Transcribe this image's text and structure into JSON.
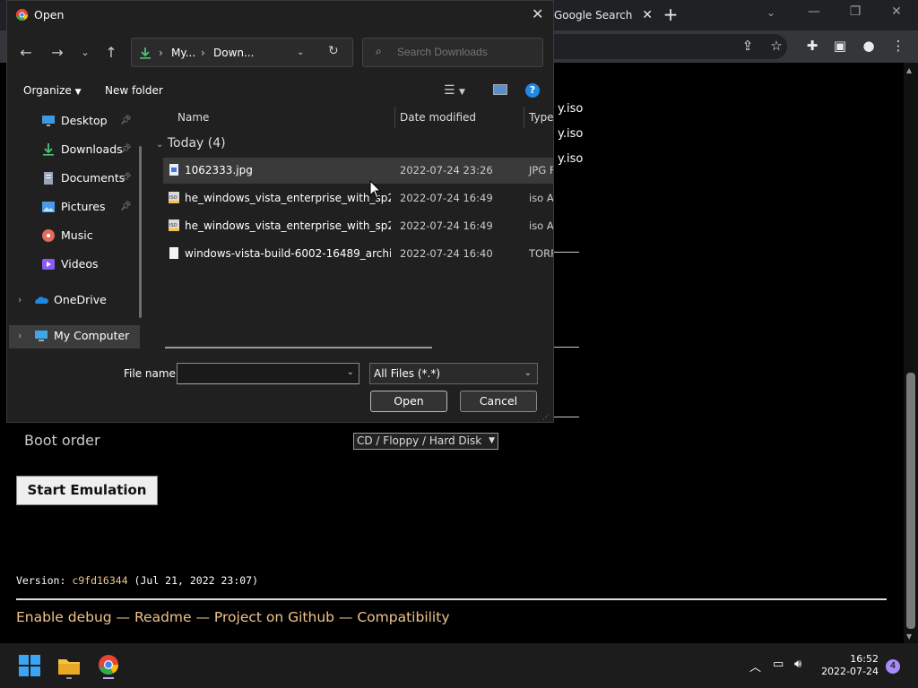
{
  "browser": {
    "tab_title": "Google Search",
    "tab_close": "✕",
    "new_tab": "+",
    "minimize": "—",
    "restore": "❐",
    "close": "✕"
  },
  "webpage": {
    "iso_lines": [
      "y.iso",
      "y.iso",
      "y.iso"
    ],
    "boot_order_label": "Boot order",
    "boot_order_value": "CD / Floppy / Hard Disk",
    "start_button": "Start Emulation",
    "version_prefix": "Version: ",
    "version_hash": "c9fd16344",
    "version_date": " (Jul 21, 2022 23:07)",
    "footer_links": [
      "Enable debug",
      "Readme",
      "Project on Github",
      "Compatibility"
    ],
    "footer_separator": " — "
  },
  "dialog": {
    "title": "Open",
    "close": "✕",
    "breadcrumb": [
      "My...",
      "Down..."
    ],
    "search_placeholder": "Search Downloads",
    "organize_label": "Organize",
    "new_folder_label": "New folder",
    "nav_items": [
      {
        "label": "Desktop",
        "icon": "desktop-icon",
        "pinned": true
      },
      {
        "label": "Downloads",
        "icon": "downloads-icon",
        "pinned": true
      },
      {
        "label": "Documents",
        "icon": "documents-icon",
        "pinned": true
      },
      {
        "label": "Pictures",
        "icon": "pictures-icon",
        "pinned": true
      },
      {
        "label": "Music",
        "icon": "music-icon",
        "pinned": false
      },
      {
        "label": "Videos",
        "icon": "videos-icon",
        "pinned": false
      },
      {
        "label": "OneDrive",
        "icon": "onedrive-icon",
        "pinned": false
      },
      {
        "label": "My Computer",
        "icon": "computer-icon",
        "pinned": false,
        "selected": true
      }
    ],
    "columns": {
      "name": "Name",
      "date": "Date modified",
      "type": "Type"
    },
    "group_label": "Today (4)",
    "files": [
      {
        "name": "1062333.jpg",
        "date": "2022-07-24 23:26",
        "type": "JPG F",
        "icon": "image-file-icon",
        "selected": true
      },
      {
        "name": "he_windows_vista_enterprise_with_sp2_x...",
        "date": "2022-07-24 16:49",
        "type": "iso A",
        "icon": "disc-image-icon"
      },
      {
        "name": "he_windows_vista_enterprise_with_sp2_x...",
        "date": "2022-07-24 16:49",
        "type": "iso A",
        "icon": "disc-image-icon"
      },
      {
        "name": "windows-vista-build-6002-16489_archive....",
        "date": "2022-07-24 16:40",
        "type": "TORR",
        "icon": "file-icon"
      }
    ],
    "file_name_label": "File name:",
    "file_name_value": "",
    "file_type_value": "All Files (*.*)",
    "open_button": "Open",
    "cancel_button": "Cancel"
  },
  "taskbar": {
    "time": "16:52",
    "date": "2022-07-24",
    "notification_count": "4"
  },
  "colors": {
    "link": "#f0c48a",
    "accent_blue": "#3b82f6",
    "dialog_bg": "#202020"
  }
}
